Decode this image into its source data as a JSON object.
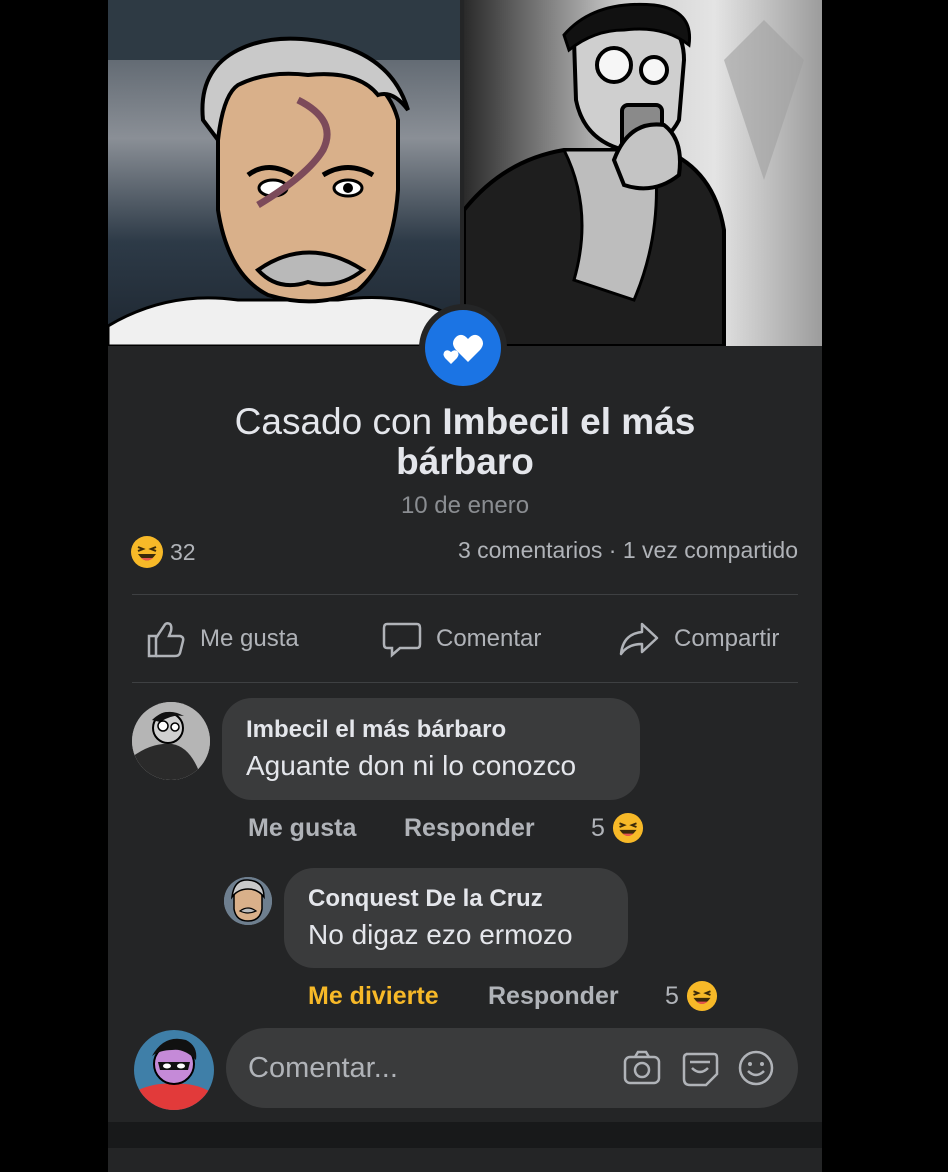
{
  "colors": {
    "background": "#242526",
    "bubble": "#3a3b3c",
    "primary_text": "#e4e6eb",
    "secondary_text": "#b0b3b8",
    "accent_blue": "#1b74e4",
    "haha_yellow": "#f7b928"
  },
  "post": {
    "headline_prefix": "Casado con",
    "headline_name": "Imbecil el más bárbaro",
    "date": "10 de enero",
    "reaction_icon": "haha-emoji-icon",
    "reaction_count": "32",
    "stats": "3 comentarios · 1 vez compartido"
  },
  "actions": {
    "like": "Me gusta",
    "comment": "Comentar",
    "share": "Compartir"
  },
  "comments": [
    {
      "author": "Imbecil el más bárbaro",
      "text": "Aguante don ni lo conozco",
      "reaction_label": "Me gusta",
      "reply_label": "Responder",
      "reaction_count": "5"
    },
    {
      "author": "Conquest De la Cruz",
      "text": "No digaz ezo ermozo",
      "reaction_label": "Me divierte",
      "reply_label": "Responder",
      "reaction_count": "5"
    }
  ],
  "composer": {
    "placeholder": "Comentar..."
  }
}
